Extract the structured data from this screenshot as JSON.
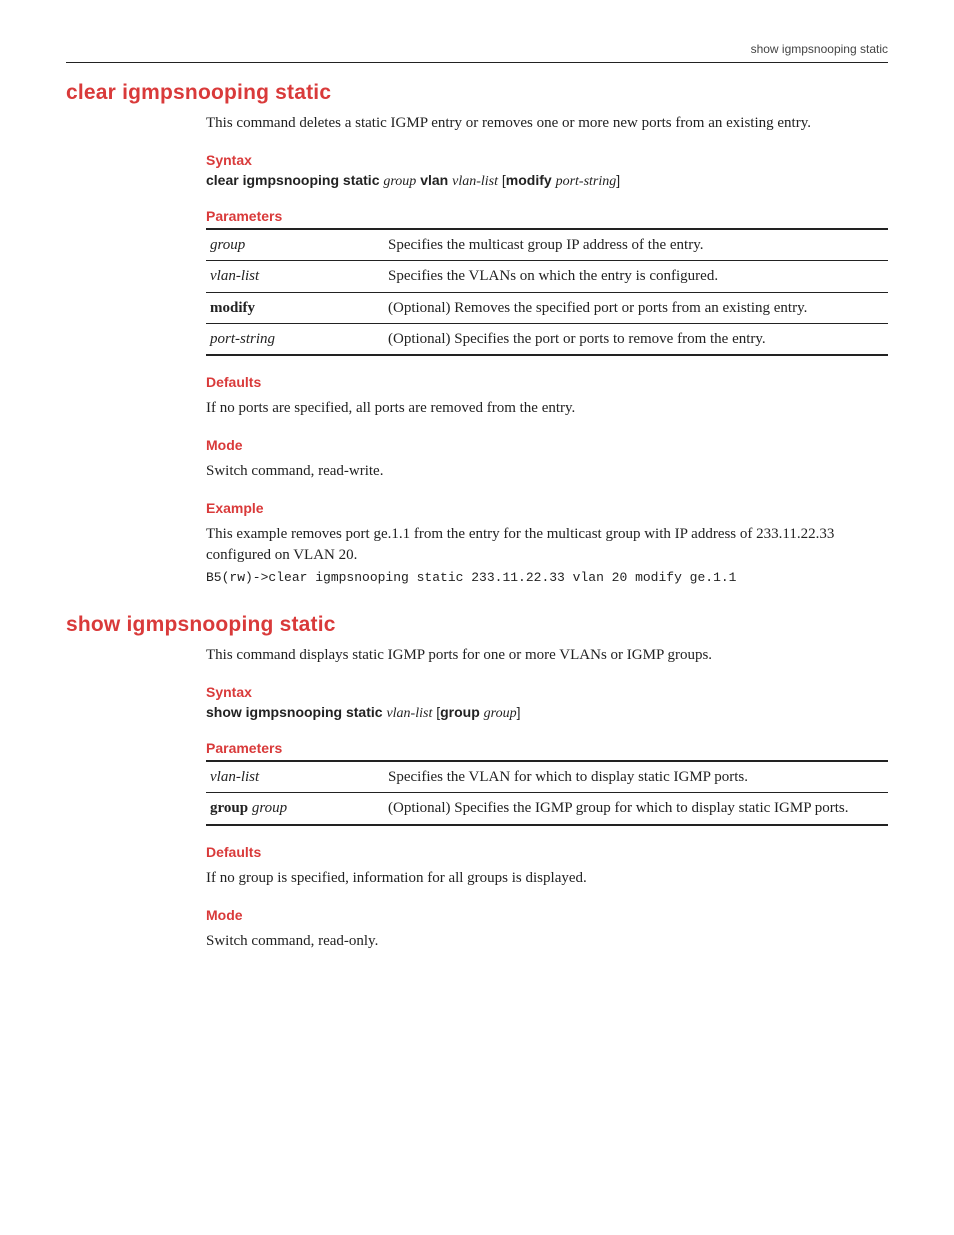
{
  "header": {
    "breadcrumb": "show igmpsnooping static"
  },
  "cmd1": {
    "title": "clear igmpsnooping static",
    "intro": "This command deletes a static IGMP entry or removes one or more new ports from an existing entry.",
    "syntax_heading": "Syntax",
    "syntax_html": "<span class='kw'>clear igmpsnooping static</span> <span class='arg'>group</span> <span class='kw'>vlan</span> <span class='arg'>vlan-list</span> [<span class='kw'>modify</span> <span class='arg'>port-string</span>]",
    "params_heading": "Parameters",
    "params": [
      {
        "name_html": "<span class='arg'>group</span>",
        "desc": "Specifies the multicast group IP address of the entry."
      },
      {
        "name_html": "<span class='arg'>vlan-list</span>",
        "desc": "Specifies the VLANs on which the entry is configured."
      },
      {
        "name_html": "<span class='kw'>modify</span>",
        "desc": "(Optional) Removes the specified port or ports from an existing entry."
      },
      {
        "name_html": "<span class='arg'>port-string</span>",
        "desc": "(Optional) Specifies the port or ports to remove from the entry."
      }
    ],
    "defaults_heading": "Defaults",
    "defaults_text": "If no ports are specified, all ports are removed from the entry.",
    "mode_heading": "Mode",
    "mode_text": "Switch command, read-write.",
    "example_heading": "Example",
    "example_text": "This example removes port ge.1.1 from the entry for the multicast group with IP address of 233.11.22.33 configured on VLAN 20.",
    "example_code": "B5(rw)->clear igmpsnooping static 233.11.22.33 vlan 20 modify ge.1.1"
  },
  "cmd2": {
    "title": "show igmpsnooping static",
    "intro": "This command displays static IGMP ports for one or more VLANs or IGMP groups.",
    "syntax_heading": "Syntax",
    "syntax_html": "<span class='kw'>show igmpsnooping static</span> <span class='arg'>vlan-list</span> [<span class='kw'>group</span> <span class='arg'>group</span>]",
    "params_heading": "Parameters",
    "params": [
      {
        "name_html": "<span class='arg'>vlan-list</span>",
        "desc": "Specifies the VLAN for which to display static IGMP ports."
      },
      {
        "name_html": "<span class='kw'>group</span> <span class='arg'>group</span>",
        "desc": "(Optional) Specifies the IGMP group for which to display static IGMP ports."
      }
    ],
    "defaults_heading": "Defaults",
    "defaults_text": "If no group is specified, information for all groups is displayed.",
    "mode_heading": "Mode",
    "mode_text": "Switch command, read-only."
  }
}
